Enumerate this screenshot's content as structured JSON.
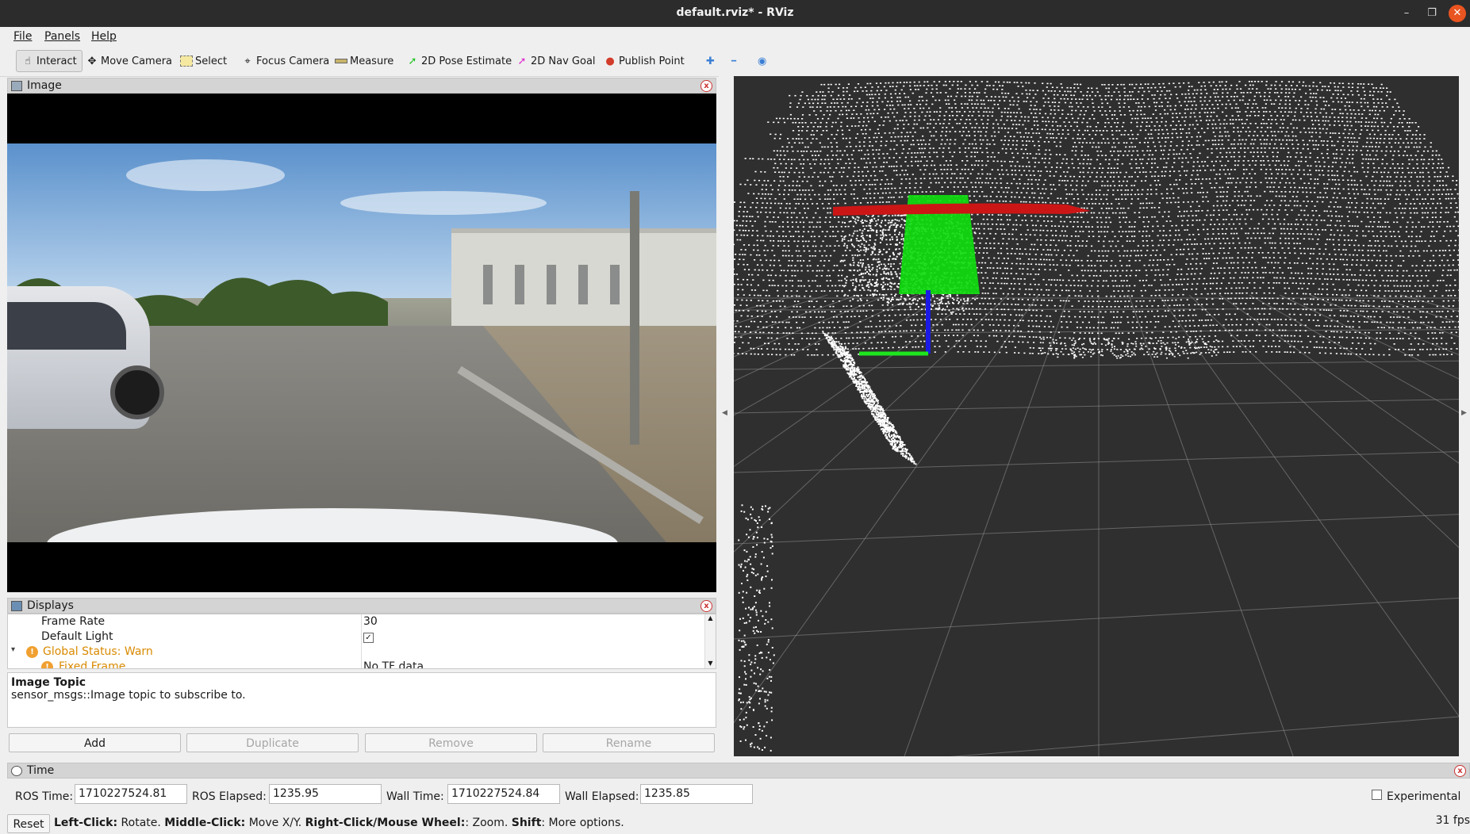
{
  "window": {
    "title": "default.rviz* - RViz",
    "minimize_glyph": "–",
    "restore_glyph": "❐",
    "close_glyph": "✕"
  },
  "menu": {
    "file": "File",
    "panels": "Panels",
    "help": "Help"
  },
  "toolbar": {
    "interact": "Interact",
    "move_camera": "Move Camera",
    "select": "Select",
    "focus_camera": "Focus Camera",
    "measure": "Measure",
    "pose_estimate": "2D Pose Estimate",
    "nav_goal": "2D Nav Goal",
    "publish_point": "Publish Point",
    "add_tool_glyph": "✚",
    "remove_tool_glyph": "━",
    "view_glyph": "◉"
  },
  "image_panel": {
    "title": "Image",
    "close_glyph": "x"
  },
  "displays_panel": {
    "title": "Displays",
    "close_glyph": "x",
    "rows": [
      {
        "key": "Frame Rate",
        "value": "30"
      },
      {
        "key": "Default Light",
        "value": "✓"
      },
      {
        "key": "Global Status: Warn",
        "value": ""
      },
      {
        "key": "Fixed Frame",
        "value": "No TF data"
      }
    ],
    "expand_glyph": "▾",
    "scroll_up": "▲",
    "scroll_down": "▼"
  },
  "description": {
    "heading": "Image Topic",
    "text": "sensor_msgs::Image topic to subscribe to."
  },
  "buttons": {
    "add": "Add",
    "duplicate": "Duplicate",
    "remove": "Remove",
    "rename": "Rename"
  },
  "time_panel": {
    "title": "Time",
    "ros_time_label": "ROS Time:",
    "ros_time": "1710227524.81",
    "ros_elapsed_label": "ROS Elapsed:",
    "ros_elapsed": "1235.95",
    "wall_time_label": "Wall Time:",
    "wall_time": "1710227524.84",
    "wall_elapsed_label": "Wall Elapsed:",
    "wall_elapsed": "1235.85",
    "experimental_label": "Experimental"
  },
  "status_bar": {
    "reset": "Reset",
    "left_click": "Left-Click:",
    "left_click_desc": " Rotate. ",
    "middle_click": "Middle-Click:",
    "middle_click_desc": " Move X/Y. ",
    "right_click": "Right-Click/Mouse Wheel:",
    "right_click_desc": ": Zoom. ",
    "shift": "Shift",
    "shift_desc": ": More options.",
    "fps": "31 fps"
  },
  "colors": {
    "background": "#2f2f2f",
    "grid": "#8a8a8a",
    "points": "#ffffff",
    "ground_highlight": "#10dd10",
    "wall_highlight": "#cc1616",
    "axis_z": "#1a1ae6",
    "axis_x": "#1ee61e"
  }
}
